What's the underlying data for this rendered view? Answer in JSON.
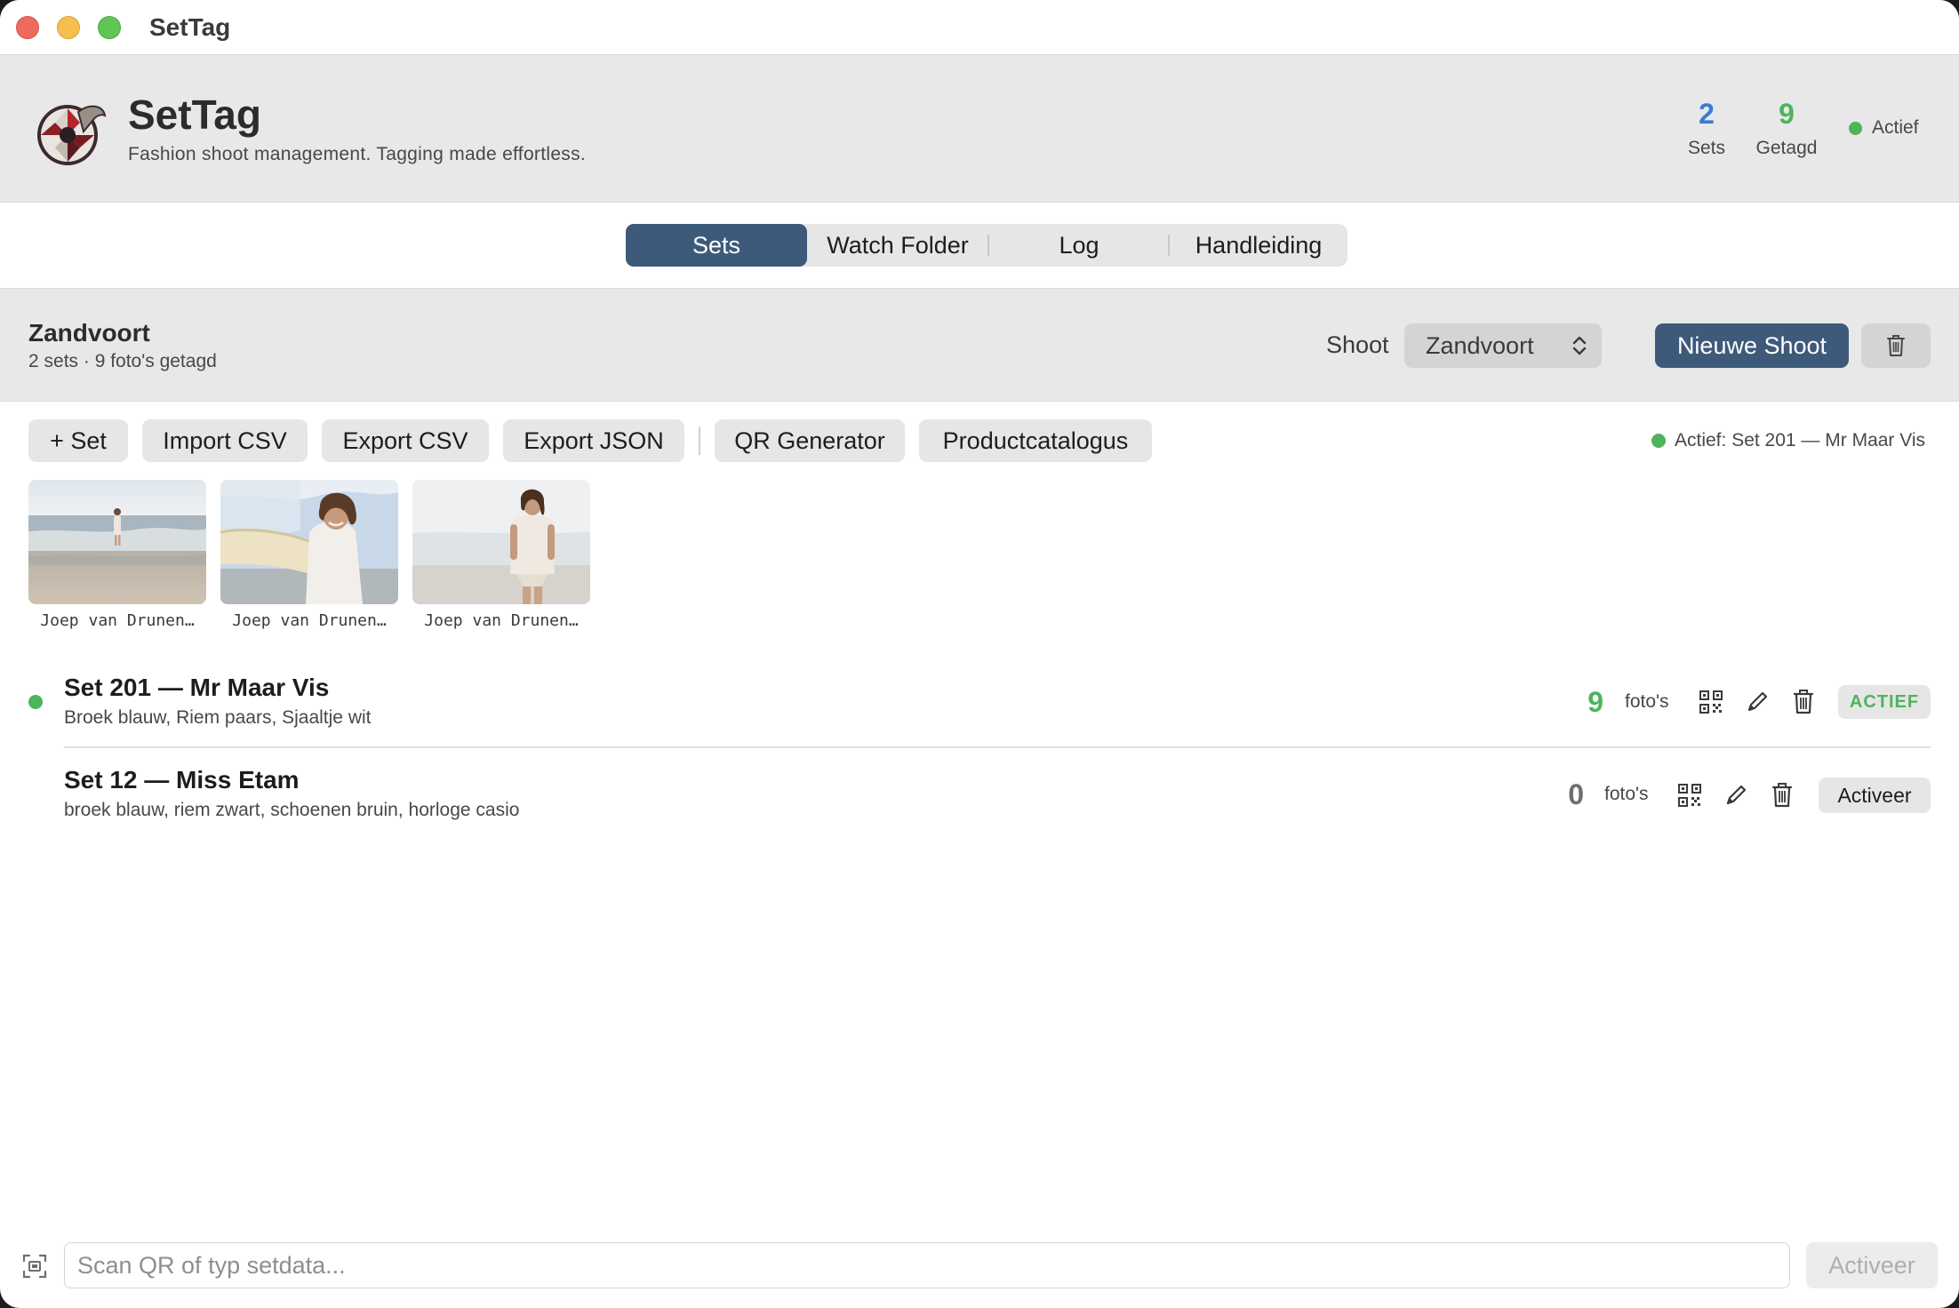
{
  "window": {
    "title": "SetTag"
  },
  "header": {
    "app_name": "SetTag",
    "tagline": "Fashion shoot management. Tagging made effortless.",
    "stats": [
      {
        "value": "2",
        "label": "Sets",
        "color": "#3a7bd5"
      },
      {
        "value": "9",
        "label": "Getagd",
        "color": "#4fb35e"
      }
    ],
    "status": "Actief"
  },
  "tabs": [
    {
      "label": "Sets",
      "active": true
    },
    {
      "label": "Watch Folder",
      "active": false
    },
    {
      "label": "Log",
      "active": false
    },
    {
      "label": "Handleiding",
      "active": false
    }
  ],
  "shoot": {
    "name": "Zandvoort",
    "summary": "2 sets · 9 foto's getagd",
    "select_label": "Shoot",
    "selected": "Zandvoort",
    "new_button": "Nieuwe Shoot"
  },
  "toolbar": {
    "buttons": [
      "+ Set",
      "Import CSV",
      "Export CSV",
      "Export JSON",
      "QR Generator",
      "Productcatalogus"
    ],
    "active_set": "Actief: Set 201 — Mr Maar Vis"
  },
  "thumbnails": [
    {
      "caption": "Joep van Drunen…"
    },
    {
      "caption": "Joep van Drunen…"
    },
    {
      "caption": "Joep van Drunen…"
    }
  ],
  "sets": [
    {
      "title": "Set 201 — Mr Maar Vis",
      "description": "Broek blauw, Riem paars, Sjaaltje wit",
      "count": "9",
      "count_label": "foto's",
      "count_color": "#4fb35e",
      "status": "ACTIEF",
      "is_active": true
    },
    {
      "title": "Set 12 — Miss Etam",
      "description": "broek blauw, riem zwart, schoenen bruin, horloge casio",
      "count": "0",
      "count_label": "foto's",
      "count_color": "#6e6e73",
      "action": "Activeer",
      "is_active": false
    }
  ],
  "scanbar": {
    "placeholder": "Scan QR of typ setdata...",
    "button": "Activeer"
  },
  "colors": {
    "accent": "#3e5a7a",
    "success": "#4fb35e",
    "info": "#3a7bd5"
  }
}
